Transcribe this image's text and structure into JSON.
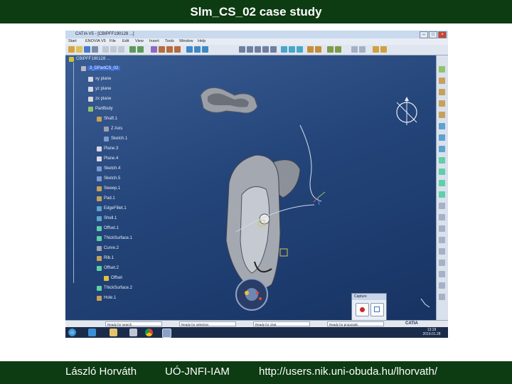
{
  "slide": {
    "title": "Slm_CS_02 case study",
    "footer_author": "László Horváth",
    "footer_institute": "UÓ-JNFI-IAM",
    "footer_url": "http://users.nik.uni-obuda.hu/lhorvath/"
  },
  "colors": {
    "slide_band": "#0d3b12",
    "viewport": "#24457a",
    "tree_text": "#e6ecf8"
  },
  "window": {
    "title": "CATIA V5 - [CBIPFF190128 ...]",
    "menu": [
      "Start",
      "ENOVIA V5",
      "File",
      "Edit",
      "View",
      "Insert",
      "Tools",
      "Window",
      "Help"
    ]
  },
  "tree": {
    "root": "CBIPFF190128 ...",
    "part": "3_DPartCS_02",
    "items": [
      "xy plane",
      "yz plane",
      "zx plane",
      "PartBody",
      "Shaft.1",
      "Z Axis",
      "Sketch.1",
      "Plane.3",
      "Plane.4",
      "Sketch.4",
      "Sketch.5",
      "Sweep.1",
      "Pad.1",
      "EdgeFillet.1",
      "Shell.1",
      "Offset.1",
      "ThickSurface.1",
      "Curve.2",
      "Rib.1",
      "Offset.2",
      "Offset",
      "ThickSurface.2",
      "Hole.1"
    ]
  },
  "capture": {
    "title": "Capture"
  },
  "status": {
    "field1": "Ready for search",
    "field2": "Ready for selection",
    "field3": "Ready for chat",
    "field4": "Ready for proposals",
    "catia_logo": "CATIA"
  },
  "taskbar": {
    "clock_time": "13:18",
    "clock_date": "2019.01.28"
  }
}
